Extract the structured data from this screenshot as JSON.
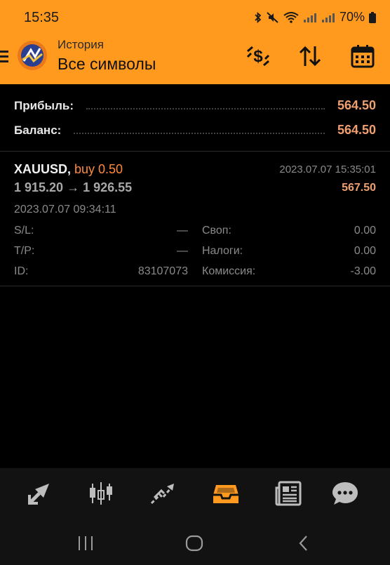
{
  "status_bar": {
    "time": "15:35",
    "battery": "70%"
  },
  "header": {
    "subtitle": "История",
    "title": "Все символы",
    "accent_color": "#ff9a1f",
    "icons": [
      "menu-icon",
      "app-logo",
      "currency-exchange-icon",
      "sort-icon",
      "calendar-icon"
    ]
  },
  "summary": {
    "profit_label": "Прибыль:",
    "profit_value": "564.50",
    "balance_label": "Баланс:",
    "balance_value": "564.50",
    "value_color": "#f0a070"
  },
  "deal": {
    "symbol": "XAUUSD,",
    "side": "buy 0.50",
    "close_time": "2023.07.07 15:35:01",
    "prices": "1 915.20 → 1 926.55",
    "profit": "567.50",
    "open_time": "2023.07.07 09:34:11",
    "rows": [
      {
        "label1": "S/L:",
        "value1": "—",
        "label2": "Своп:",
        "value2": "0.00"
      },
      {
        "label1": "T/P:",
        "value1": "—",
        "label2": "Налоги:",
        "value2": "0.00"
      },
      {
        "label1": "ID:",
        "value1": "83107073",
        "label2": "Комиссия:",
        "value2": "-3.00"
      }
    ]
  },
  "tabs": [
    {
      "name": "quotes-icon",
      "active": false
    },
    {
      "name": "chart-candles-icon",
      "active": false
    },
    {
      "name": "trade-icon",
      "active": false
    },
    {
      "name": "history-icon",
      "active": true
    },
    {
      "name": "news-icon",
      "active": false
    },
    {
      "name": "messages-icon",
      "active": false
    }
  ],
  "nav": [
    "recent-apps-icon",
    "home-icon",
    "back-icon"
  ]
}
